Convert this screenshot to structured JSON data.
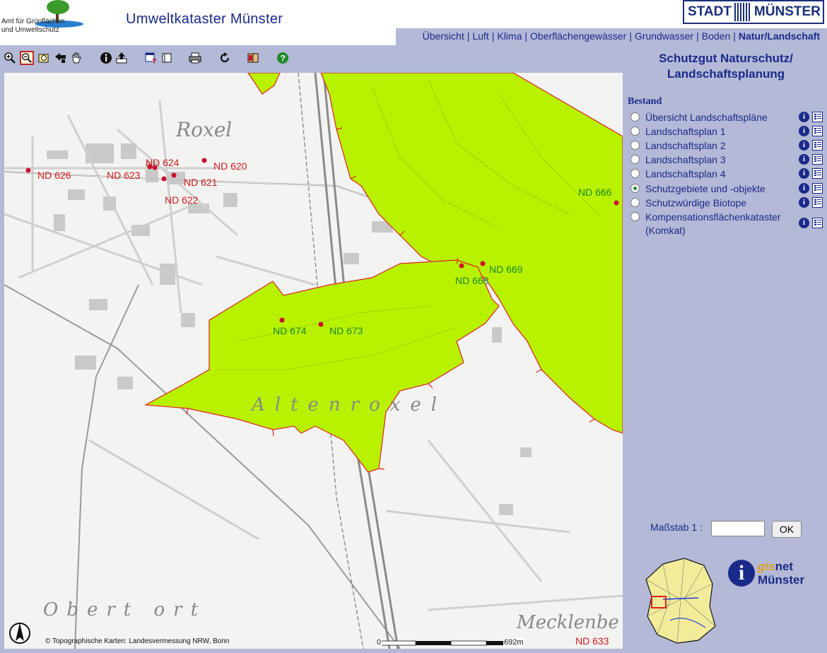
{
  "header": {
    "amt_text": "Amt für Grünflächen und Umweltschutz",
    "title": "Umweltkataster Münster",
    "stadt_logo_left": "STADT",
    "stadt_logo_right": "MÜNSTER"
  },
  "nav": {
    "items": [
      {
        "label": "Übersicht",
        "active": false
      },
      {
        "label": "Luft",
        "active": false
      },
      {
        "label": "Klima",
        "active": false
      },
      {
        "label": "Oberflächengewässer",
        "active": false
      },
      {
        "label": "Grundwasser",
        "active": false
      },
      {
        "label": "Boden",
        "active": false
      },
      {
        "label": "Natur/Landschaft",
        "active": true
      }
    ],
    "separator": "|"
  },
  "toolbar": {
    "tools": [
      "zoom-in-icon",
      "zoom-out-icon",
      "zoom-extent-icon",
      "back-icon",
      "pan-hand-icon",
      "info-icon",
      "export-icon",
      "query-icon",
      "print-icon",
      "refresh-icon",
      "book-icon",
      "help-icon"
    ]
  },
  "map": {
    "labels": [
      {
        "text": "ND 626",
        "color": "red"
      },
      {
        "text": "ND 623",
        "color": "red"
      },
      {
        "text": "ND 624",
        "color": "red"
      },
      {
        "text": "ND 620",
        "color": "red"
      },
      {
        "text": "ND 621",
        "color": "red"
      },
      {
        "text": "ND 622",
        "color": "red"
      },
      {
        "text": "ND 666",
        "color": "green"
      },
      {
        "text": "ND 669",
        "color": "green"
      },
      {
        "text": "ND 668",
        "color": "green"
      },
      {
        "text": "ND 674",
        "color": "green"
      },
      {
        "text": "ND 673",
        "color": "green"
      },
      {
        "text": "ND 633",
        "color": "red"
      }
    ],
    "place_names": [
      "Roxel",
      "Altenroxel",
      "Obert ort",
      "Mecklenbe"
    ],
    "copyright": "© Topographische Karten: Landesvermessung NRW, Bonn",
    "scale_start": "0",
    "scale_end": "692m",
    "protected_area_color": "#b8f200",
    "point_color": "#c8102e"
  },
  "panel": {
    "title_line1": "Schutzgut Naturschutz/",
    "title_line2": "Landschaftsplanung",
    "section": "Bestand",
    "layers": [
      {
        "label": "Übersicht Landschaftspläne",
        "checked": false
      },
      {
        "label": "Landschaftsplan 1",
        "checked": false
      },
      {
        "label": "Landschaftsplan 2",
        "checked": false
      },
      {
        "label": "Landschaftsplan 3",
        "checked": false
      },
      {
        "label": "Landschaftsplan 4",
        "checked": false
      },
      {
        "label": "Schutzgebiete und -objekte",
        "checked": true
      },
      {
        "label": "Schutzwürdige Biotope",
        "checked": false
      },
      {
        "label": "Kompensationsflächenkataster",
        "label2": "(Komkat)",
        "checked": false
      }
    ],
    "scale_label": "Maßstab 1 :",
    "scale_value": "",
    "ok_label": "OK",
    "gisnet_gis": "gis",
    "gisnet_net": "net",
    "gisnet_city": "Münster"
  }
}
